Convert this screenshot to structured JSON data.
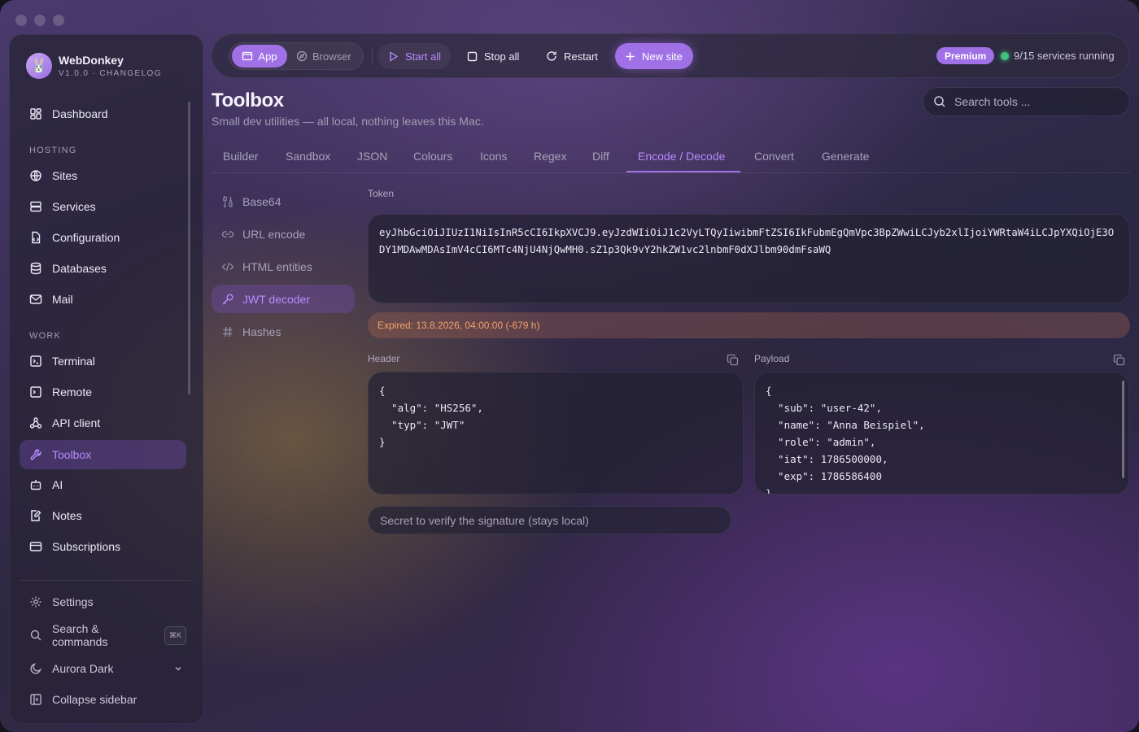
{
  "brand": {
    "name": "WebDonkey",
    "subtitle": "V1.0.0 · CHANGELOG",
    "logo_icon": "bunny-logo"
  },
  "sidebar": {
    "dashboard": "Dashboard",
    "hosting_label": "HOSTING",
    "hosting": [
      "Sites",
      "Services",
      "Configuration",
      "Databases",
      "Mail"
    ],
    "work_label": "WORK",
    "work": [
      "Terminal",
      "Remote",
      "API client",
      "Toolbox",
      "AI",
      "Notes",
      "Subscriptions"
    ],
    "active": "Toolbox",
    "settings": "Settings",
    "search": "Search & commands",
    "search_shortcut": "⌘K",
    "theme": "Aurora Dark",
    "collapse": "Collapse sidebar"
  },
  "topbar": {
    "app": "App",
    "browser": "Browser",
    "start_all": "Start all",
    "stop_all": "Stop all",
    "restart": "Restart",
    "new_site": "New site",
    "premium": "Premium",
    "status": "9/15 services running",
    "status_color": "#3fc27a"
  },
  "page": {
    "title": "Toolbox",
    "subtitle": "Small dev utilities — all local, nothing leaves this Mac.",
    "search_placeholder": "Search tools ..."
  },
  "tabs": [
    "Builder",
    "Sandbox",
    "JSON",
    "Colours",
    "Icons",
    "Regex",
    "Diff",
    "Encode / Decode",
    "Convert",
    "Generate"
  ],
  "active_tab": "Encode / Decode",
  "subnav": [
    "Base64",
    "URL encode",
    "HTML entities",
    "JWT decoder",
    "Hashes"
  ],
  "active_subnav": "JWT decoder",
  "jwt": {
    "token_label": "Token",
    "token": "eyJhbGciOiJIUzI1NiIsInR5cCI6IkpXVCJ9.eyJzdWIiOiJ1c2VyLTQyIiwibmFtZSI6IkFubmEgQmVpc3BpZWwiLCJyb2xlIjoiYWRtaW4iLCJpYXQiOjE3ODY1MDAwMDAsImV4cCI6MTc4NjU4NjQwMH0.sZ1p3Qk9vY2hkZW1vc2lnbmF0dXJlbm90dmFsaWQ",
    "expired": "Expired: 13.8.2026, 04:00:00 (-679 h)",
    "header_label": "Header",
    "payload_label": "Payload",
    "header_json": "{\n  \"alg\": \"HS256\",\n  \"typ\": \"JWT\"\n}",
    "payload_json": "{\n  \"sub\": \"user-42\",\n  \"name\": \"Anna Beispiel\",\n  \"role\": \"admin\",\n  \"iat\": 1786500000,\n  \"exp\": 1786586400\n}",
    "secret_placeholder": "Secret to verify the signature (stays local)"
  },
  "colors": {
    "accent": "#a070e6",
    "accent_text": "#b88bff",
    "warning": "#f0a36b"
  }
}
